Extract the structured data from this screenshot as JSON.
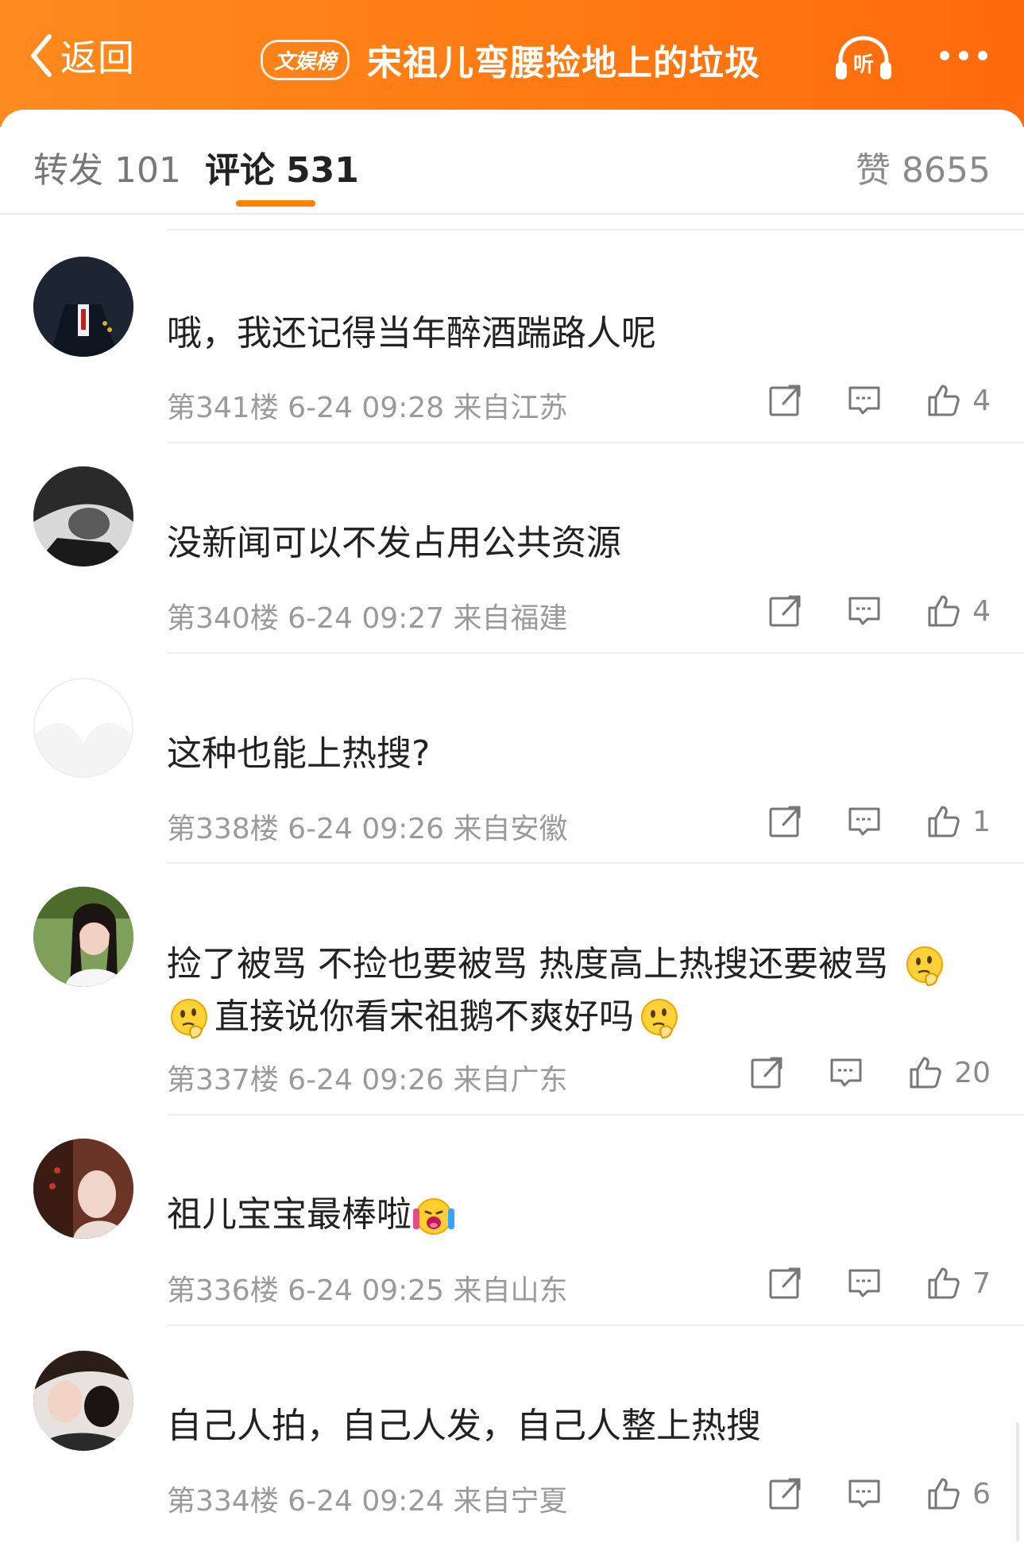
{
  "header": {
    "back_label": "返回",
    "tag": "文娱榜",
    "title": "宋祖儿弯腰捡地上的垃圾",
    "listen_label": "听",
    "background": "#ff7a12"
  },
  "tabs": {
    "forward_label": "转发",
    "forward_count": "101",
    "comment_label": "评论",
    "comment_count": "531",
    "like_label": "赞",
    "like_count": "8655",
    "active": "评论",
    "indicator_color": "#ff8200"
  },
  "comments": [
    {
      "text": "哦，我还记得当年醉酒踹路人呢",
      "floor": "第341楼",
      "time": "6-24 09:28",
      "location": "来自江苏",
      "likes": "4"
    },
    {
      "text": "没新闻可以不发占用公共资源",
      "floor": "第340楼",
      "time": "6-24 09:27",
      "location": "来自福建",
      "likes": "4"
    },
    {
      "text": "这种也能上热搜?",
      "floor": "第338楼",
      "time": "6-24 09:26",
      "location": "来自安徽",
      "likes": "1"
    },
    {
      "text_part1": "捡了被骂 不捡也要被骂 热度高上热搜还要被骂",
      "text_part2": "直接说你看宋祖鹅不爽好吗",
      "emoji": "thinking-face",
      "floor": "第337楼",
      "time": "6-24 09:26",
      "location": "来自广东",
      "likes": "20"
    },
    {
      "text": "祖儿宝宝最棒啦",
      "emoji": "screaming-face",
      "floor": "第336楼",
      "time": "6-24 09:25",
      "location": "来自山东",
      "likes": "7"
    },
    {
      "text": "自己人拍，自己人发，自己人整上热搜",
      "floor": "第334楼",
      "time": "6-24 09:24",
      "location": "来自宁夏",
      "likes": "6"
    }
  ]
}
